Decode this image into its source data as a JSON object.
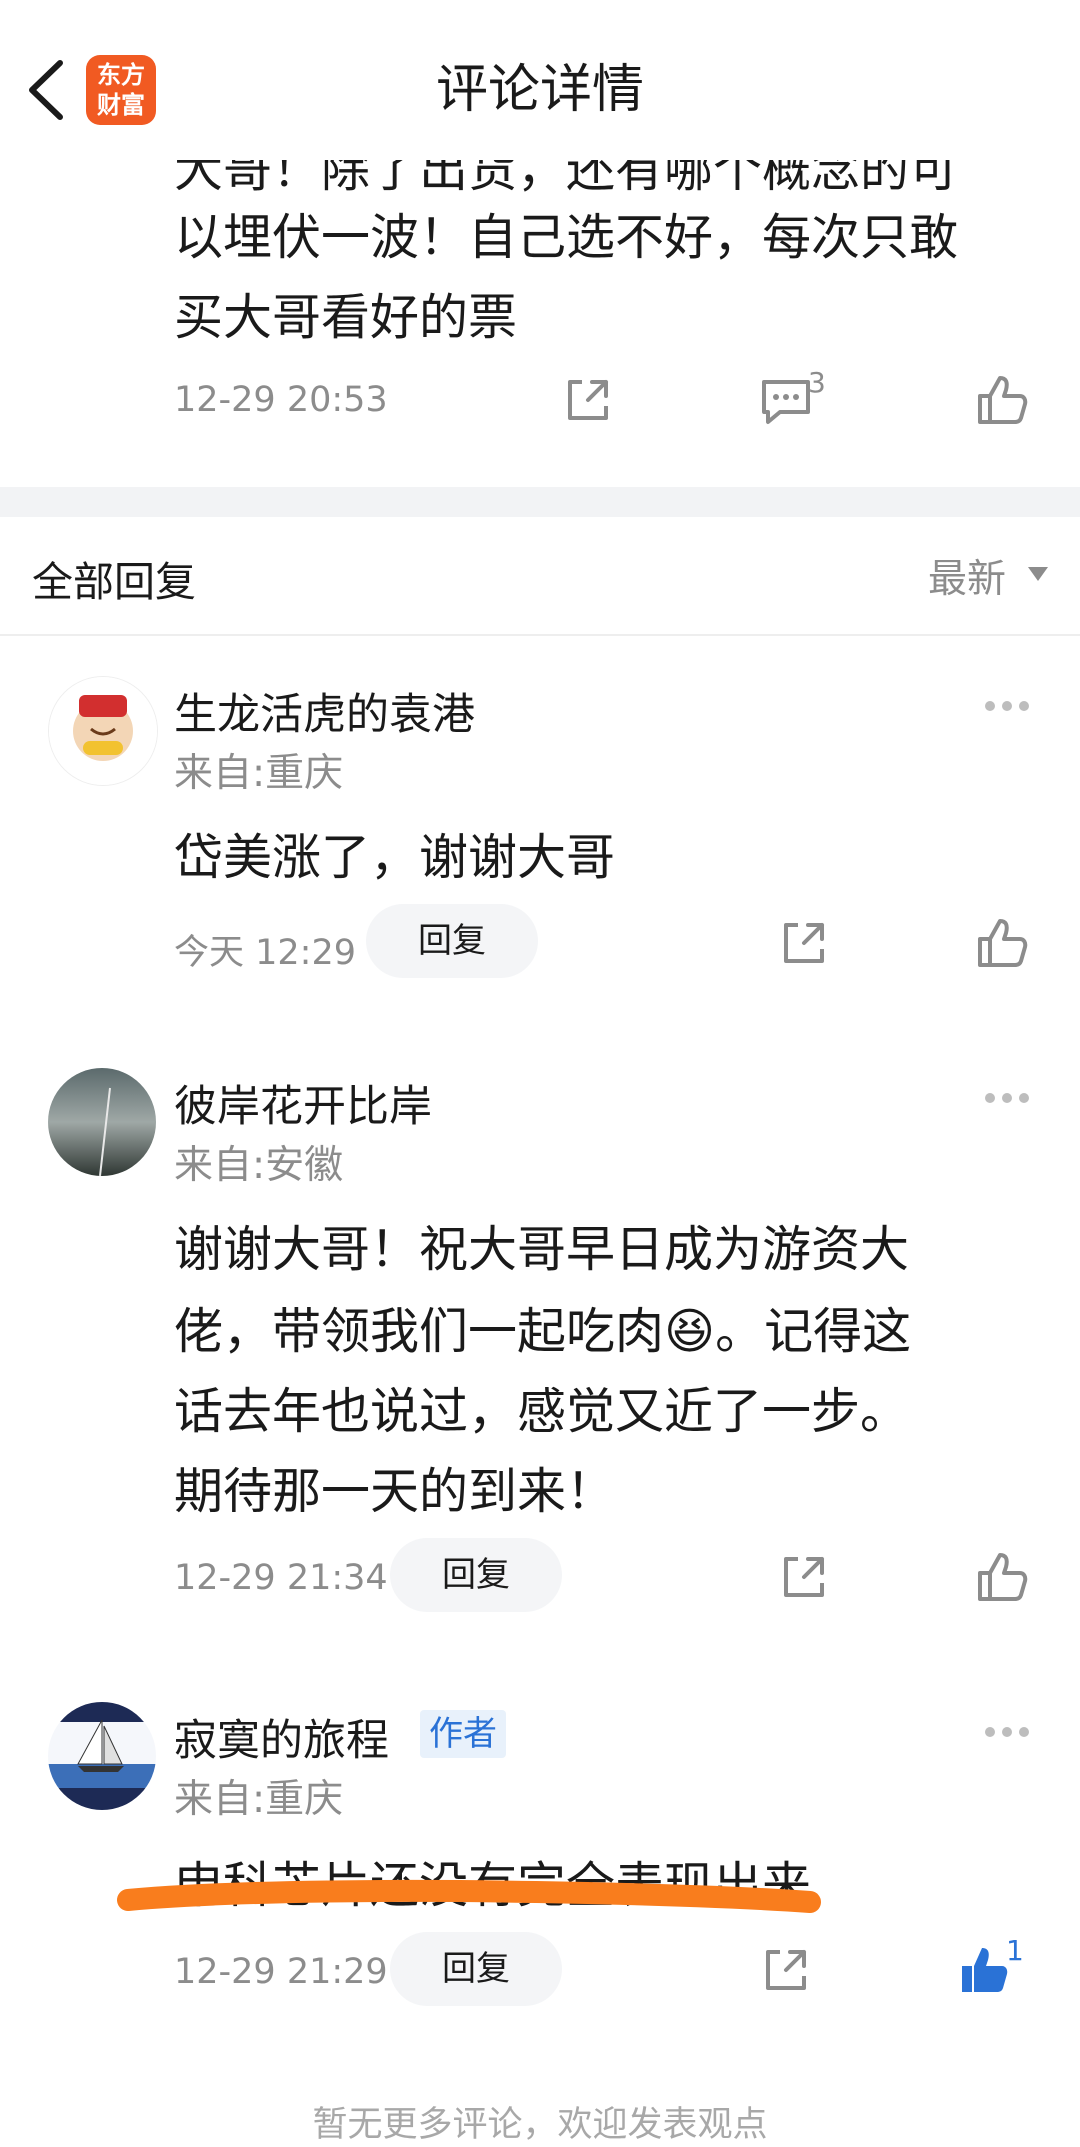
{
  "header": {
    "title": "评论详情",
    "logo_line1": "东方",
    "logo_line2": "财富"
  },
  "main_post": {
    "lines": [
      "大哥！除了出货，还有哪个概念的可",
      "以埋伏一波！自己选不好，每次只敢",
      "买大哥看好的票"
    ],
    "time": "12-29 20:53",
    "reply_count": "3"
  },
  "replies_section": {
    "title": "全部回复",
    "sort": "最新"
  },
  "comments": [
    {
      "username": "生龙活虎的袁港",
      "location": "来自:重庆",
      "lines": [
        "岱美涨了，谢谢大哥"
      ],
      "time": "今天 12:29",
      "reply_label": "回复"
    },
    {
      "username": "彼岸花开比岸",
      "location": "来自:安徽",
      "lines": [
        "谢谢大哥！祝大哥早日成为游资大",
        "佬，带领我们一起吃肉😆。记得这",
        "话去年也说过，感觉又近了一步。",
        "期待那一天的到来！"
      ],
      "time": "12-29 21:34",
      "reply_label": "回复"
    },
    {
      "username": "寂寞的旅程",
      "author_tag": "作者",
      "location": "来自:重庆",
      "lines": [
        "申科芯片还没有完全表现出来"
      ],
      "time": "12-29 21:29",
      "reply_label": "回复",
      "like_count": "1"
    }
  ],
  "footer": "暂无更多评论，欢迎发表观点",
  "colors": {
    "accent_blue": "#2a72d6",
    "brand_orange": "#f15a22",
    "highlight_orange": "#f97d1d"
  }
}
